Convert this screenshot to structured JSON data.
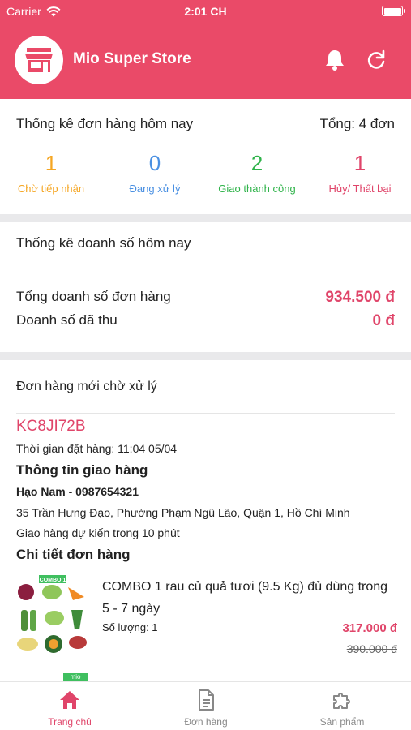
{
  "status_bar": {
    "carrier": "Carrier",
    "time": "2:01 CH"
  },
  "header": {
    "title": "Mio Super Store",
    "icons": [
      "store-icon",
      "bell-icon",
      "refresh-icon"
    ],
    "bg_color": "#ea4a68"
  },
  "order_stats": {
    "title": "Thống kê đơn hàng hôm nay",
    "total": "Tổng: 4 đơn",
    "items": [
      {
        "count": "1",
        "label": "Chờ tiếp nhận",
        "color": "#f5a623"
      },
      {
        "count": "0",
        "label": "Đang xử lý",
        "color": "#4a90e2"
      },
      {
        "count": "2",
        "label": "Giao thành công",
        "color": "#2fb34a"
      },
      {
        "count": "1",
        "label": "Hủy/ Thất bại",
        "color": "#e0456a"
      }
    ]
  },
  "revenue": {
    "title": "Thống kê doanh số hôm nay",
    "rows": [
      {
        "label": "Tổng doanh số đơn hàng",
        "value": "934.500 đ"
      },
      {
        "label": "Doanh số đã thu",
        "value": "0 đ"
      }
    ]
  },
  "pending_orders": {
    "title": "Đơn hàng mới chờ xử lý",
    "order": {
      "code": "KC8JI72B",
      "order_time": "Thời gian đặt hàng: 11:04 05/04",
      "delivery_heading": "Thông tin giao hàng",
      "customer": "Hạo Nam - 0987654321",
      "address": "35 Trần Hưng Đạo, Phường Phạm Ngũ Lão,  Quận 1, Hồ Chí Minh",
      "eta": "Giao hàng dự kiến trong 10 phút",
      "details_heading": "Chi tiết đơn hàng",
      "product": {
        "image_label": "COMBO 1",
        "name": "COMBO 1 rau củ quả tươi (9.5 Kg) đủ dùng trong 5 - 7 ngày",
        "quantity": "Số lượng: 1",
        "price": "317.000 đ",
        "old_price": "390.000 đ"
      },
      "next_item_badge": "mio"
    }
  },
  "tabbar": {
    "tabs": [
      {
        "label": "Trang chủ",
        "icon": "home-icon",
        "active": true
      },
      {
        "label": "Đơn hàng",
        "icon": "document-icon",
        "active": false
      },
      {
        "label": "Sản phẩm",
        "icon": "puzzle-icon",
        "active": false
      }
    ]
  }
}
